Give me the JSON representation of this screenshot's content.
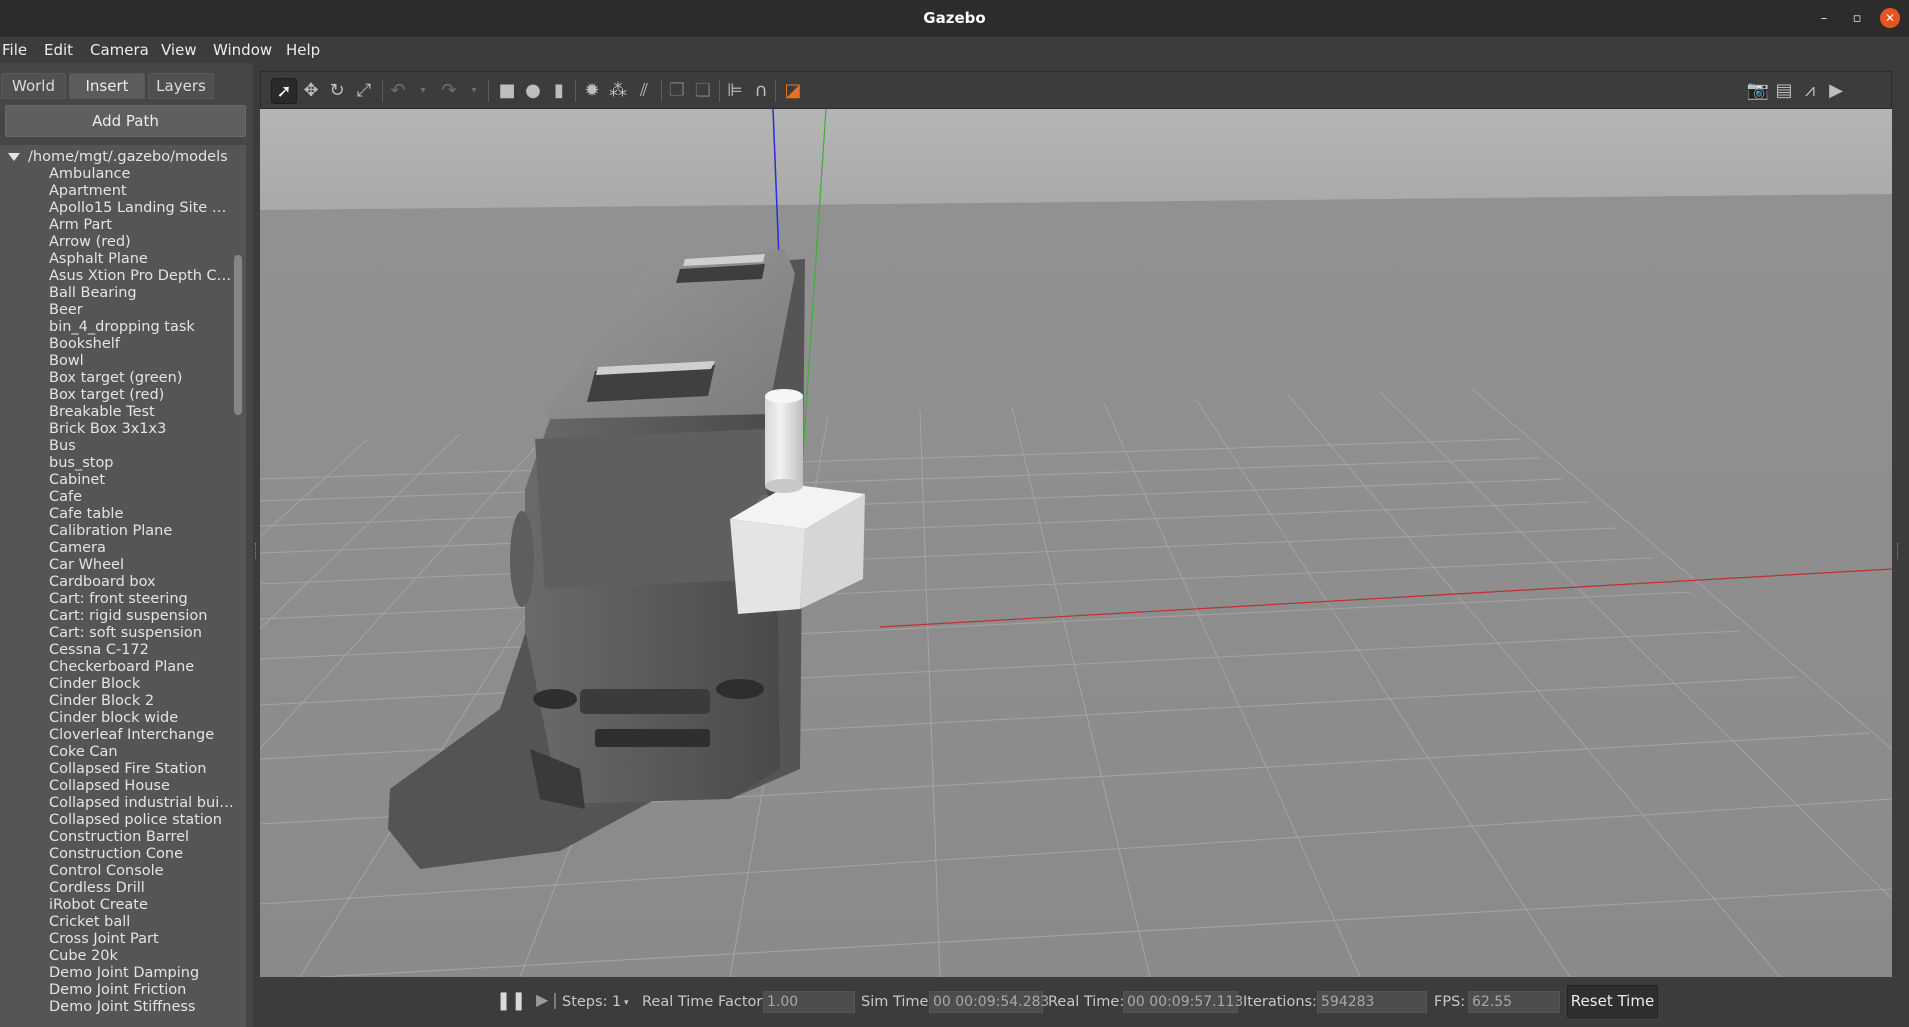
{
  "window": {
    "title": "Gazebo",
    "controls": [
      "minimize-icon",
      "restore-icon",
      "close-icon"
    ]
  },
  "menu": [
    "File",
    "Edit",
    "Camera",
    "View",
    "Window",
    "Help"
  ],
  "left_panel": {
    "tabs": [
      {
        "label": "World",
        "active": false
      },
      {
        "label": "Insert",
        "active": true
      },
      {
        "label": "Layers",
        "active": false
      }
    ],
    "add_path_label": "Add Path",
    "root_path": "/home/mgt/.gazebo/models",
    "models": [
      "Ambulance",
      "Apartment",
      "Apollo15 Landing Site H...",
      "Arm Part",
      "Arrow (red)",
      "Asphalt Plane",
      "Asus Xtion Pro Depth Ca...",
      "Ball Bearing",
      "Beer",
      "bin_4_dropping task",
      "Bookshelf",
      "Bowl",
      "Box target (green)",
      "Box target (red)",
      "Breakable Test",
      "Brick Box 3x1x3",
      "Bus",
      "bus_stop",
      "Cabinet",
      "Cafe",
      "Cafe table",
      "Calibration Plane",
      "Camera",
      "Car Wheel",
      "Cardboard box",
      "Cart: front steering",
      "Cart: rigid suspension",
      "Cart: soft suspension",
      "Cessna C-172",
      "Checkerboard Plane",
      "Cinder Block",
      "Cinder Block 2",
      "Cinder block wide",
      "Cloverleaf Interchange",
      "Coke Can",
      "Collapsed Fire Station",
      "Collapsed House",
      "Collapsed industrial buil...",
      "Collapsed police station",
      "Construction Barrel",
      "Construction Cone",
      "Control Console",
      "Cordless Drill",
      "iRobot Create",
      "Cricket ball",
      "Cross Joint Part",
      "Cube 20k",
      "Demo Joint Damping",
      "Demo Joint Friction",
      "Demo Joint Stiffness"
    ]
  },
  "toolbar": {
    "tools": [
      "select-arrow-icon",
      "translate-icon",
      "rotate-icon",
      "scale-icon",
      "undo-icon",
      "undo-dropdown-icon",
      "redo-icon",
      "redo-dropdown-icon",
      "box-shape-icon",
      "sphere-shape-icon",
      "cylinder-shape-icon",
      "point-light-icon",
      "spot-light-icon",
      "directional-light-icon",
      "copy-icon",
      "paste-icon",
      "align-icon",
      "snap-icon",
      "view-angle-icon"
    ],
    "right_tools": [
      "screenshot-icon",
      "log-icon",
      "plot-icon",
      "record-video-icon"
    ]
  },
  "status": {
    "steps_label": "Steps:",
    "steps_value": "1",
    "rtf_label": "Real Time Factor:",
    "rtf_value": "1.00",
    "sim_time_label": "Sim Time:",
    "sim_time_value": "00 00:09:54.283",
    "real_time_label": "Real Time:",
    "real_time_value": "00 00:09:57.113",
    "iterations_label": "Iterations:",
    "iterations_value": "594283",
    "fps_label": "FPS:",
    "fps_value": "62.55",
    "reset_label": "Reset Time"
  },
  "colors": {
    "accent_close": "#e95420",
    "view_angle_orange": "#e8731f"
  }
}
